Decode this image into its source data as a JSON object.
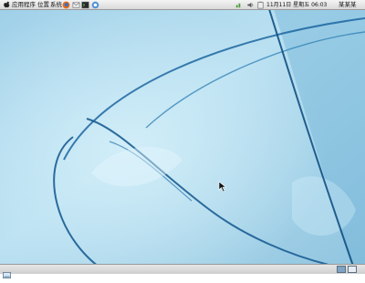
{
  "top_panel": {
    "menus": [
      "应用程序",
      "位置",
      "系统"
    ],
    "launchers": [
      "firefox-icon",
      "mail-icon",
      "terminal-icon",
      "help-icon"
    ],
    "status_icons": [
      "network-icon",
      "volume-icon",
      "clipboard-icon"
    ],
    "clock": "11月11日 星期五 06:03",
    "user": "某某某"
  },
  "colors": {
    "desktop_light": "#bfe3f2",
    "desktop_mid": "#8dc3de",
    "desktop_dark": "#3b87b9",
    "panel": "#e2e2e2"
  },
  "bottom_panel": {
    "left_icon": "show-desktop-icon",
    "workspaces": [
      "workspace-1",
      "workspace-2"
    ]
  }
}
